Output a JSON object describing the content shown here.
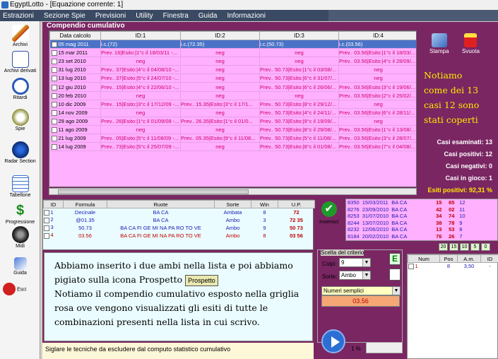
{
  "window": {
    "title": "EgyptLotto - [Equazione corrente: 1]"
  },
  "menu": [
    "Estrazioni",
    "Sezione Spie",
    "Previsioni",
    "Utility",
    "Finestra",
    "Guida",
    "Informazioni"
  ],
  "sidebar": [
    {
      "label": "Archivi",
      "icon": "pencil-icon"
    },
    {
      "label": "Archivi derivati",
      "icon": "document-pencil-icon"
    },
    {
      "label": "Ritardi",
      "icon": "clock-icon"
    },
    {
      "label": "Spie",
      "icon": "flashlight-icon"
    },
    {
      "label": "Radar Section",
      "icon": "radar-icon"
    },
    {
      "label": "Tabellone",
      "icon": "calendar-grid-icon"
    },
    {
      "label": "Progressione",
      "icon": "dollar-icon"
    },
    {
      "label": "Midi",
      "icon": "speaker-icon"
    },
    {
      "label": "Guida",
      "icon": "book-icon"
    },
    {
      "label": "Esci",
      "icon": "exit-icon"
    }
  ],
  "compendio": {
    "title": "Compendio cumulativo",
    "headers": [
      "Data calcolo",
      "ID:1",
      "ID:2",
      "ID:3",
      "ID:4"
    ],
    "rows": [
      [
        "05 mag 2011",
        "i.c.(72)",
        "i.c.(72.35)",
        "i.c.(50.73)",
        "i.c.(03.56)"
      ],
      [
        "15 mar 2011",
        "Prev. 16|Esito:|1°c il 18/03/11 -...",
        "neg",
        "neg",
        "Prev.. 03.56|Esito:|1°c il 18/03/..."
      ],
      [
        "23 set 2010",
        "neg",
        "neg",
        "neg",
        "Prev.. 03.56|Esito:|4°c il 28/09/..."
      ],
      [
        "31 lug 2010",
        "Prev.. 37|Esito:|4°c il 04/08/10 -...",
        "neg",
        "Prev.. 50.73|Esito:|1°c il 03/08/...",
        "neg"
      ],
      [
        "13 lug 2010",
        "Prev.. 37|Esito:|5°c il 24/07/10 -...",
        "neg",
        "Prev.. 50.73|Esito:|6°c il 31/07/...",
        "neg"
      ],
      [
        "12 giu 2010",
        "Prev.. 15|Esito:|4°c il 22/06/10 -...",
        "neg",
        "Prev.. 50.73|Esito:|6°c il 26/06/...",
        "Prev.. 03.56|Esito:|3°c il 19/06/..."
      ],
      [
        "20 feb 2010",
        "neg",
        "neg",
        "neg",
        "Prev.. 03.56|Esito:|2°c il 25/02/..."
      ],
      [
        "10 dic 2009",
        "Prev.. 15|Esito:|3°c il 17/12/09 -...",
        "Prev.. 15.35|Esito:|3°c il 17/1...",
        "Prev.. 50.73|Esito:|8°c il 29/12/...",
        "neg"
      ],
      [
        "14 nov 2009",
        "neg",
        "neg",
        "Prev.. 50.73|Esito:|4°c il 24/11/...",
        "Prev.. 03.56|Esito:|6°c il 28/11/..."
      ],
      [
        "29 ago 2009",
        "Prev.. 26|Esito:|1°c il 01/09/09 -...",
        "Prev.. 26.35|Esito:|1°c il 01/0...",
        "Prev.. 50.73|Esito:|9°c il 19/09/...",
        "neg"
      ],
      [
        "11 ago 2009",
        "neg",
        "neg",
        "Prev.. 50.73|Esito:|8°c il 29/08/...",
        "Prev.. 03.56|Esito:|1°c il 13/08/..."
      ],
      [
        "21 lug 2009",
        "Prev.. 05|Esito:|5°c il 11/08/09 -...",
        "Prev.. 05.35|Esito:|9°c il 11/08...",
        "Prev.. 50.73|Esito:|5°c il 11/08/...",
        "Prev.. 03.56|Esito:|3°c il 28/07/..."
      ],
      [
        "14 lug 2009",
        "Prev.. 73|Esito:|5°c il 25/07/09 -...",
        "neg",
        "Prev.. 50.73|Esito:|8°c il 01/08/...",
        "Prev.. 03.56|Esito:|7°c il 04/08/..."
      ]
    ]
  },
  "panel": {
    "stampa": "Stampa",
    "svuota": "Svuota",
    "cursive_lines": [
      "Notiamo",
      "come dei 13",
      "casi 12 sono",
      "stati coperti"
    ],
    "stats": [
      "Casi esaminati: 13",
      "Casi positivi: 12",
      "Casi negativi: 0",
      "Casi in gioco: 1",
      "Esiti positivi: 92,31 %"
    ]
  },
  "formulas": {
    "headers": [
      "ID",
      "Formula",
      "Ruote",
      "Sorte",
      "Win",
      "U.P."
    ],
    "rows": [
      [
        "1",
        "Decinale",
        "BA CA",
        "Ambata",
        "8",
        "72"
      ],
      [
        "2",
        "@01.35",
        "BA CA",
        "Ambo",
        "3",
        "72 35"
      ],
      [
        "3",
        "50.73",
        "BA CA FI GE MI NA PA RO TO VE",
        "Ambo",
        "9",
        "50 73"
      ],
      [
        "4",
        "03.56",
        "BA CA FI GE MI NA PA RO TO VE",
        "Ambo",
        "8",
        "03 56"
      ]
    ]
  },
  "inserisci": "Inserisci",
  "estrazioni": [
    [
      "8350",
      "15/03/2011",
      "BA CA",
      "15",
      "65",
      "12"
    ],
    [
      "8276",
      "23/09/2010",
      "BA CA",
      "42",
      "02",
      "11"
    ],
    [
      "8253",
      "31/07/2010",
      "BA CA",
      "34",
      "74",
      "10"
    ],
    [
      "8244",
      "13/07/2010",
      "BA CA",
      "38",
      "78",
      "9"
    ],
    [
      "8232",
      "12/06/2010",
      "BA CA",
      "13",
      "53",
      "8"
    ],
    [
      "8184",
      "20/02/2010",
      "BA CA",
      "76",
      "26",
      "7"
    ]
  ],
  "counters": [
    "20",
    "15",
    "10",
    "5",
    "0"
  ],
  "textbox": {
    "line1": "Abbiamo inserito i due ambi nella lista e poi abbiamo",
    "line2a": "pigiato sulla icona Prospetto",
    "prospetto_button": "Prospetto",
    "line3": "Notiamo il compendio cumulativo esposto nella griglia",
    "line4": "rosa ove vengono visualizzati gli esiti di tutte le",
    "line5": "combinazioni presenti nella lista in cui scrivo."
  },
  "status": "Siglare le tecniche da escludere dal computo statistico cumulativo",
  "criterio": {
    "title": "Scelta del criterio",
    "colpi_label": "Colpi:",
    "colpi_value": "9",
    "sorte_label": "Sorte:",
    "sorte_value": "Ambo",
    "tipo_value": "Numeri semplici",
    "result": "03.56",
    "e_button": "E"
  },
  "percent": "1 %",
  "numbers": {
    "headers": [
      "Num",
      "Pos",
      "A.m.",
      "ID"
    ],
    "rows": [
      [
        "1",
        "8",
        "3,50",
        "-"
      ]
    ]
  }
}
